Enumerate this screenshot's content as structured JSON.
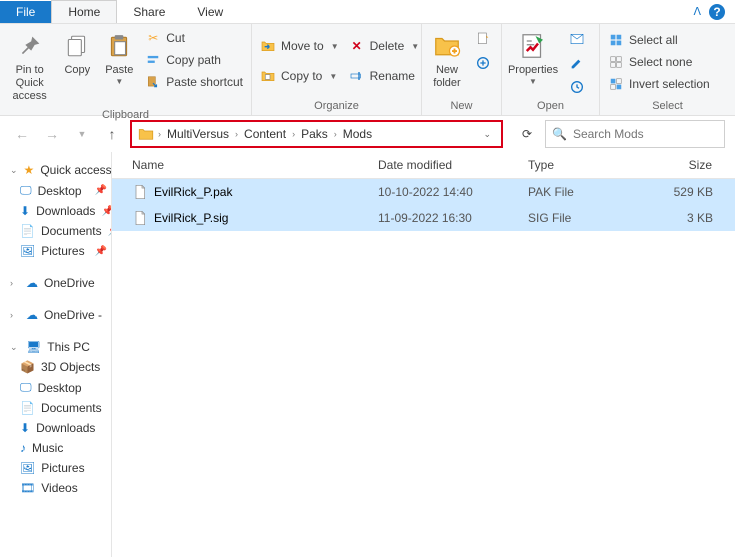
{
  "tabs": {
    "file": "File",
    "home": "Home",
    "share": "Share",
    "view": "View"
  },
  "ribbon": {
    "clipboard": {
      "label": "Clipboard",
      "pin": "Pin to Quick\naccess",
      "copy": "Copy",
      "paste": "Paste",
      "cut": "Cut",
      "copy_path": "Copy path",
      "paste_shortcut": "Paste shortcut"
    },
    "organize": {
      "label": "Organize",
      "move_to": "Move to",
      "copy_to": "Copy to",
      "delete": "Delete",
      "rename": "Rename"
    },
    "new": {
      "label": "New",
      "new_folder": "New\nfolder"
    },
    "open": {
      "label": "Open",
      "properties": "Properties"
    },
    "select": {
      "label": "Select",
      "select_all": "Select all",
      "select_none": "Select none",
      "invert": "Invert selection"
    }
  },
  "breadcrumb": [
    "MultiVersus",
    "Content",
    "Paks",
    "Mods"
  ],
  "search": {
    "placeholder": "Search Mods"
  },
  "columns": {
    "name": "Name",
    "date": "Date modified",
    "type": "Type",
    "size": "Size"
  },
  "files": [
    {
      "name": "EvilRick_P.pak",
      "date": "10-10-2022 14:40",
      "type": "PAK File",
      "size": "529 KB",
      "selected": true
    },
    {
      "name": "EvilRick_P.sig",
      "date": "11-09-2022 16:30",
      "type": "SIG File",
      "size": "3 KB",
      "selected": true
    }
  ],
  "nav": {
    "quick": "Quick access",
    "quick_items": [
      "Desktop",
      "Downloads",
      "Documents",
      "Pictures"
    ],
    "onedrive1": "OneDrive",
    "onedrive2": "OneDrive -",
    "this_pc": "This PC",
    "pc_items": [
      "3D Objects",
      "Desktop",
      "Documents",
      "Downloads",
      "Music",
      "Pictures",
      "Videos"
    ]
  }
}
